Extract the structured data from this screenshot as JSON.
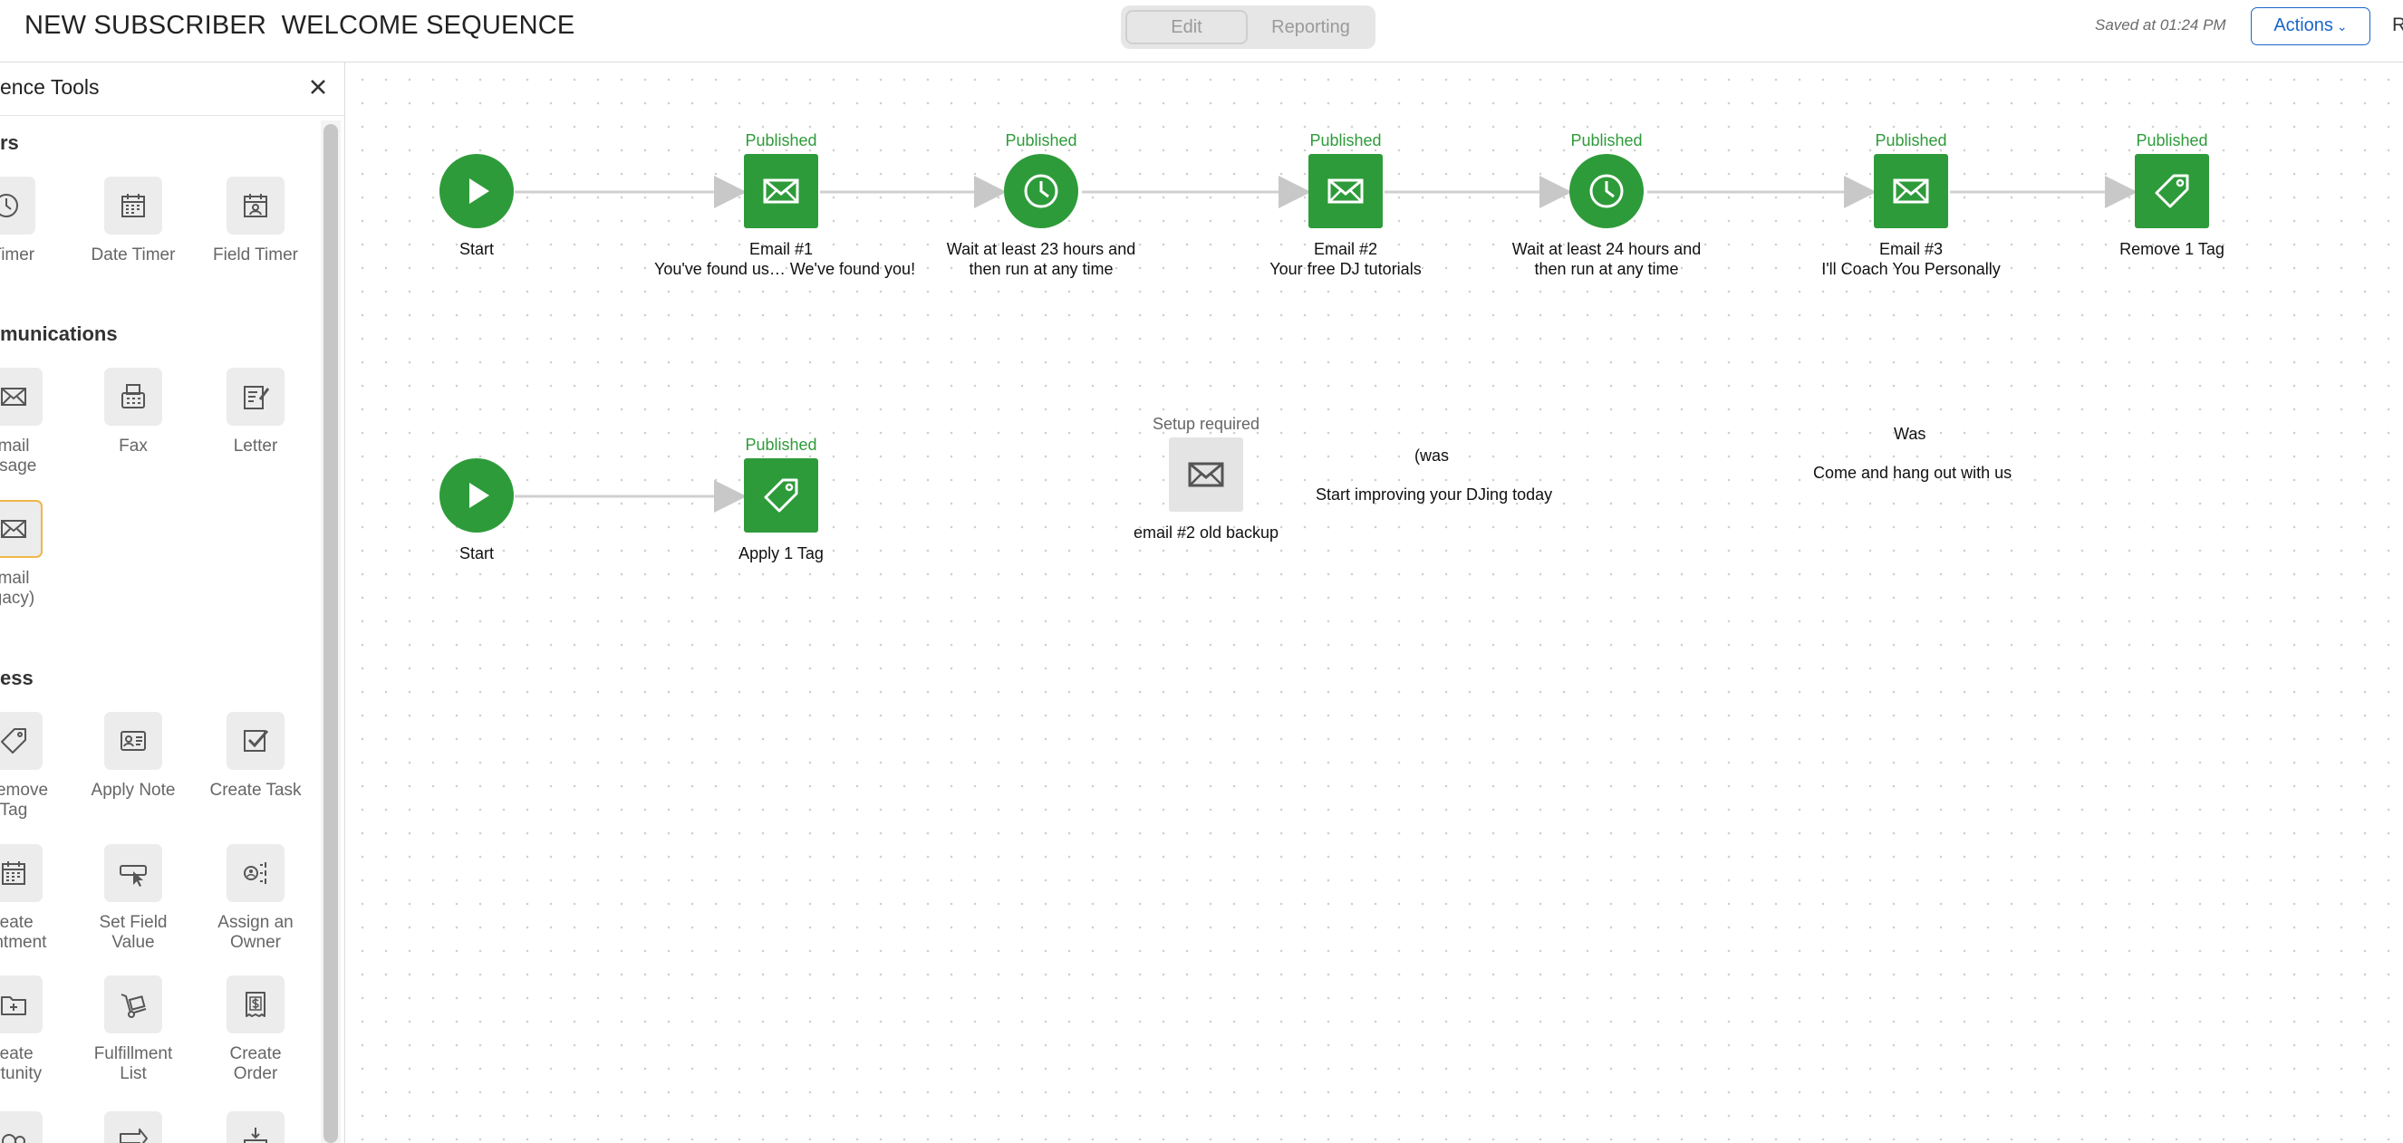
{
  "header": {
    "title": "NEW SUBSCRIBER  WELCOME SEQUENCE",
    "edit_tab": "Edit",
    "reporting_tab": "Reporting",
    "saved_text": "Saved at 01:24 PM",
    "actions_label": "Actions",
    "edge_text": "R"
  },
  "panel": {
    "title": "ence Tools",
    "sections": {
      "timers": "rs",
      "communications": "munications",
      "process": "ess"
    },
    "tools": {
      "delay_timer": "y Timer",
      "date_timer": "Date Timer",
      "field_timer": "Field Timer",
      "email_message": "mail\nssage",
      "fax": "Fax",
      "letter": "Letter",
      "email_legacy": "mail\ngacy)",
      "apply_remove_tag": "/Remove\nTag",
      "apply_note": "Apply Note",
      "create_task": "Create Task",
      "create_appointment": "reate\npintment",
      "set_field_value": "Set Field\nValue",
      "assign_owner": "Assign an\nOwner",
      "create_opportunity": "reate\nortunity",
      "fulfillment_list": "Fulfillment\nList",
      "create_order": "Create\nOrder"
    }
  },
  "sequence": {
    "row1": {
      "start_label": "Start",
      "email1": {
        "status": "Published",
        "label": "Email #1\nYou've found us… We've found you!"
      },
      "wait1": {
        "status": "Published",
        "label": "Wait at least 23 hours and\nthen run at any time"
      },
      "email2": {
        "status": "Published",
        "label": "Email #2\nYour free DJ tutorials"
      },
      "wait2": {
        "status": "Published",
        "label": "Wait at least 24 hours and\nthen run at any time"
      },
      "email3": {
        "status": "Published",
        "label": "Email #3\nI'll Coach You Personally"
      },
      "remove_tag": {
        "status": "Published",
        "label": "Remove 1 Tag"
      }
    },
    "row2": {
      "start_label": "Start",
      "apply_tag": {
        "status": "Published",
        "label": "Apply 1 Tag"
      },
      "old_email": {
        "status": "Setup required",
        "label": "email #2 old backup"
      },
      "note_was": "(was",
      "note_improve": "Start improving your DJing today",
      "note_was2": "Was",
      "note_hangout": "Come and hang out with us"
    }
  },
  "colors": {
    "published_green": "#2e9b3a",
    "actions_blue": "#1a66c9",
    "connector_gray": "#d0d0d0"
  },
  "icons": {
    "start": "play-icon",
    "email": "envelope-icon",
    "wait": "clock-icon",
    "tag": "tag-icon",
    "close": "close-icon"
  }
}
